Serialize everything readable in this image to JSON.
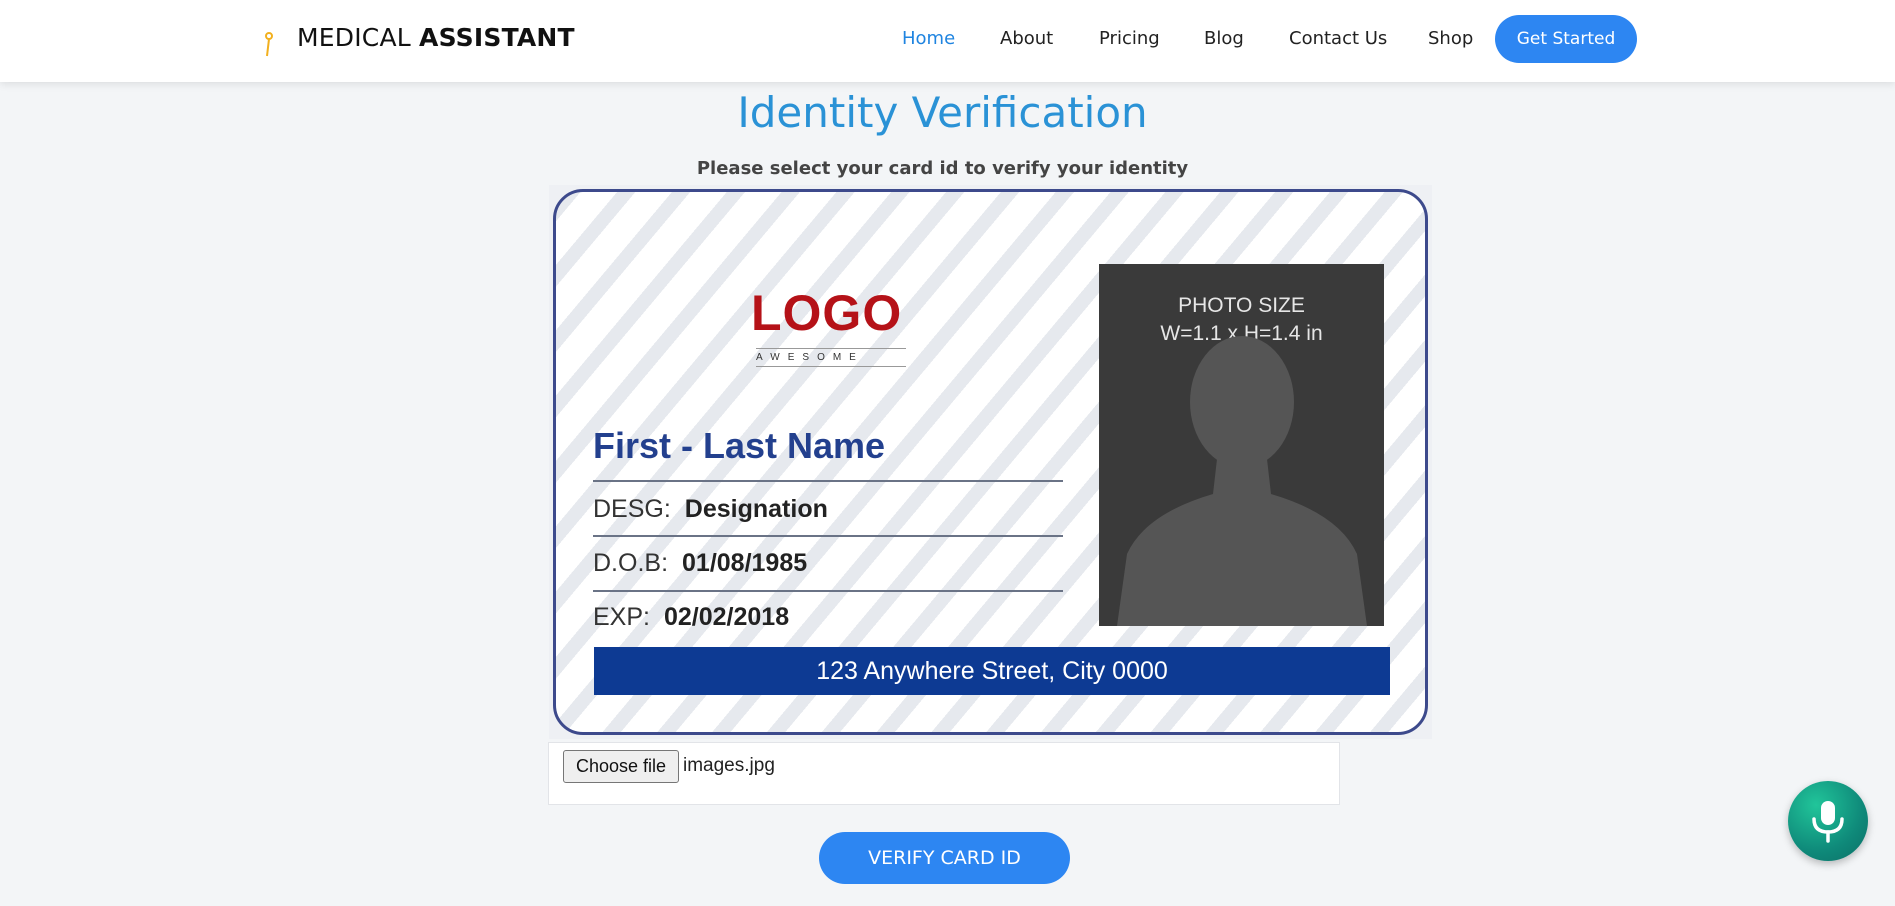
{
  "brand": {
    "light": "MEDICAL ",
    "bold": "ASSISTANT"
  },
  "nav": {
    "items": [
      {
        "label": "Home",
        "active": true
      },
      {
        "label": "About",
        "active": false
      },
      {
        "label": "Pricing",
        "active": false
      },
      {
        "label": "Blog",
        "active": false
      },
      {
        "label": "Contact Us",
        "active": false
      },
      {
        "label": "Shop",
        "active": false
      }
    ],
    "cta": "Get Started"
  },
  "page": {
    "title": "Identity Verification",
    "subtitle": "Please select your card id to verify your identity"
  },
  "card": {
    "logo": "LOGO",
    "logo_sub": "AWESOME",
    "name": "First - Last Name",
    "desg_label": "DESG:",
    "desg_value": "Designation",
    "dob_label": "D.O.B:",
    "dob_value": "01/08/1985",
    "exp_label": "EXP:",
    "exp_value": "02/02/2018",
    "photo_line1": "PHOTO SIZE",
    "photo_line2": "W=1.1 x H=1.4 in",
    "address": "123 Anywhere Street, City 0000"
  },
  "file_input": {
    "button": "Choose file",
    "file_name": "images.jpg"
  },
  "verify_button": "VERIFY CARD ID",
  "colors": {
    "accent": "#2d86f2",
    "title": "#2a92d6",
    "mic": "#0f8a7a"
  }
}
